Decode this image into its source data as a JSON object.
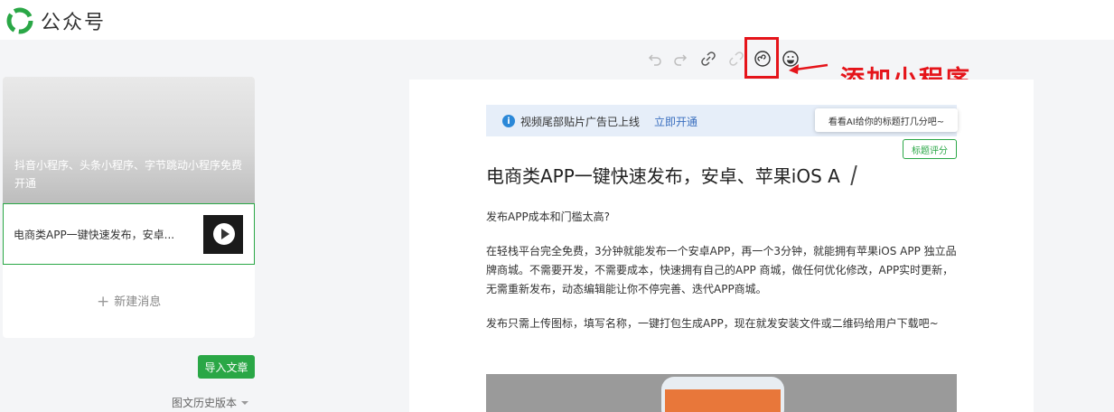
{
  "header": {
    "brand": "公众号"
  },
  "toolbar": {
    "undo": "undo-icon",
    "redo": "redo-icon",
    "link": "link-icon",
    "unlink": "unlink-icon",
    "miniprogram": "miniprogram-icon",
    "emoji": "emoji-icon"
  },
  "annotation": {
    "text": "添加小程序",
    "color": "#e5141a"
  },
  "left_panel": {
    "cover_title": "抖音小程序、头条小程序、字节跳动小程序免费开通",
    "article_title": "电商类APP一键快速发布，安卓...",
    "new_message": "新建消息",
    "import_button": "导入文章",
    "history": "图文历史版本"
  },
  "editor": {
    "notice_text": "视频尾部贴片广告已上线",
    "notice_link": "立即开通",
    "tooltip": "看看AI给你的标题打几分吧~",
    "score_button": "标题评分",
    "title": "电商类APP一键快速发布，安卓、苹果iOS A",
    "paragraphs": [
      "发布APP成本和门槛太高?",
      "在轻栈平台完全免费，3分钟就能发布一个安卓APP，再一个3分钟，就能拥有苹果iOS APP 独立品牌商城。不需要开发，不需要成本，快速拥有自己的APP 商城，做任何优化修改，APP实时更新，无需重新发布，动态编辑能让你不停完善、迭代APP商城。",
      "发布只需上传图标，填写名称，一键打包生成APP，现在就发安装文件或二维码给用户下载吧~"
    ]
  },
  "colors": {
    "brand_green": "#2aa746",
    "notice_bg": "#e6eef9",
    "link_blue": "#3a6fbf"
  }
}
